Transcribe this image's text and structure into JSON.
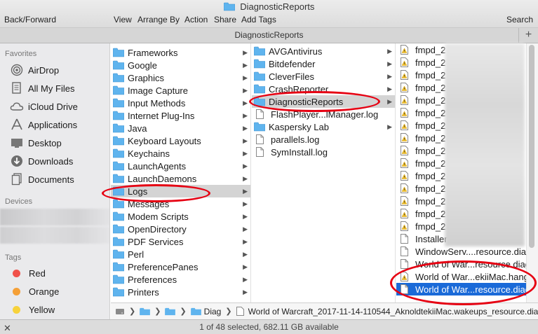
{
  "window": {
    "title": "DiagnosticReports",
    "tab_title": "DiagnosticReports",
    "tab_add": "+"
  },
  "toolbar": {
    "back_forward": "Back/Forward",
    "view": "View",
    "arrange_by": "Arrange By",
    "action": "Action",
    "share": "Share",
    "add_tags": "Add Tags",
    "search": "Search"
  },
  "sidebar": {
    "favorites_header": "Favorites",
    "favorites": [
      {
        "label": "AirDrop",
        "icon": "airdrop-icon"
      },
      {
        "label": "All My Files",
        "icon": "all-files-icon"
      },
      {
        "label": "iCloud Drive",
        "icon": "cloud-icon"
      },
      {
        "label": "Applications",
        "icon": "applications-icon"
      },
      {
        "label": "Desktop",
        "icon": "desktop-icon"
      },
      {
        "label": "Downloads",
        "icon": "downloads-icon"
      },
      {
        "label": "Documents",
        "icon": "documents-icon"
      }
    ],
    "devices_header": "Devices",
    "tags_header": "Tags",
    "tags": [
      {
        "label": "Red",
        "color": "#f0514a"
      },
      {
        "label": "Orange",
        "color": "#f5a037"
      },
      {
        "label": "Yellow",
        "color": "#f7d23b"
      }
    ]
  },
  "column1": [
    {
      "label": "Frameworks"
    },
    {
      "label": "Google"
    },
    {
      "label": "Graphics"
    },
    {
      "label": "Image Capture"
    },
    {
      "label": "Input Methods"
    },
    {
      "label": "Internet Plug-Ins"
    },
    {
      "label": "Java"
    },
    {
      "label": "Keyboard Layouts"
    },
    {
      "label": "Keychains"
    },
    {
      "label": "LaunchAgents"
    },
    {
      "label": "LaunchDaemons"
    },
    {
      "label": "Logs",
      "selected": true
    },
    {
      "label": "Messages"
    },
    {
      "label": "Modem Scripts"
    },
    {
      "label": "OpenDirectory"
    },
    {
      "label": "PDF Services"
    },
    {
      "label": "Perl"
    },
    {
      "label": "PreferencePanes"
    },
    {
      "label": "Preferences"
    },
    {
      "label": "Printers"
    }
  ],
  "column2": [
    {
      "label": "AVGAntivirus",
      "type": "folder"
    },
    {
      "label": "Bitdefender",
      "type": "folder"
    },
    {
      "label": "CleverFiles",
      "type": "folder"
    },
    {
      "label": "CrashReporter",
      "type": "folder"
    },
    {
      "label": "DiagnosticReports",
      "type": "folder",
      "selected": true
    },
    {
      "label": "FlashPlayer...lManager.log",
      "type": "file"
    },
    {
      "label": "Kaspersky Lab",
      "type": "folder"
    },
    {
      "label": "parallels.log",
      "type": "file"
    },
    {
      "label": "SymInstall.log",
      "type": "file"
    }
  ],
  "column3": [
    {
      "label": "fmpd_2",
      "type": "warn"
    },
    {
      "label": "fmpd_2",
      "type": "warn"
    },
    {
      "label": "fmpd_2",
      "type": "warn"
    },
    {
      "label": "fmpd_2",
      "type": "warn"
    },
    {
      "label": "fmpd_2",
      "type": "warn"
    },
    {
      "label": "fmpd_2",
      "type": "warn"
    },
    {
      "label": "fmpd_2",
      "type": "warn"
    },
    {
      "label": "fmpd_2",
      "type": "warn"
    },
    {
      "label": "fmpd_2",
      "type": "warn"
    },
    {
      "label": "fmpd_2",
      "type": "warn"
    },
    {
      "label": "fmpd_2",
      "type": "warn"
    },
    {
      "label": "fmpd_2",
      "type": "warn"
    },
    {
      "label": "fmpd_2",
      "type": "warn"
    },
    {
      "label": "fmpd_2",
      "type": "warn"
    },
    {
      "label": "fmpd_2",
      "type": "warn"
    },
    {
      "label": "Installer",
      "type": "doc"
    },
    {
      "label": "WindowServ....resource.diag",
      "type": "doc"
    },
    {
      "label": "World of War...resource.diag",
      "type": "doc"
    },
    {
      "label": "World of War...ekiiMac.hang",
      "type": "warn"
    },
    {
      "label": "World of War...resource.diag",
      "type": "doc",
      "selected": true
    }
  ],
  "pathbar": {
    "segment_short": "Diag",
    "file": "World of Warcraft_2017-11-14-110544_AknoldtekiiMac.wakeups_resource.diag"
  },
  "status": {
    "text": "1 of 48 selected, 682.11 GB available"
  },
  "colors": {
    "folder": "#5fb4ee",
    "selection": "#1a6ad8",
    "annotation": "#e60012"
  }
}
